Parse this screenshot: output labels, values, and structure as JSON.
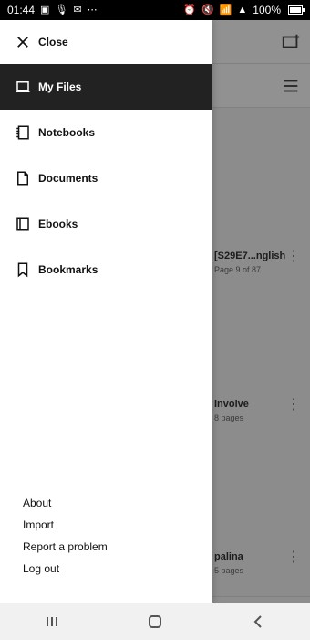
{
  "status_bar": {
    "time": "01:44",
    "left_icons": [
      "image-icon",
      "microphone-icon",
      "mail-icon",
      "more-icon"
    ],
    "right_icons": [
      "alarm-icon",
      "mute-icon",
      "wifi-icon",
      "signal-icon"
    ],
    "battery": "100%"
  },
  "drawer": {
    "close_label": "Close",
    "items": [
      {
        "label": "My Files",
        "icon": "laptop-icon",
        "active": true
      },
      {
        "label": "Notebooks",
        "icon": "notebook-icon",
        "active": false
      },
      {
        "label": "Documents",
        "icon": "document-icon",
        "active": false
      },
      {
        "label": "Ebooks",
        "icon": "book-icon",
        "active": false
      },
      {
        "label": "Bookmarks",
        "icon": "bookmark-icon",
        "active": false
      }
    ],
    "footer_links": [
      {
        "label": "About"
      },
      {
        "label": "Import"
      },
      {
        "label": "Report a problem"
      },
      {
        "label": "Log out"
      }
    ]
  },
  "background": {
    "files": [
      {
        "title": "[S29E7...nglish",
        "subtitle": "Page 9 of 87"
      },
      {
        "title": "Involve",
        "subtitle": "8 pages"
      },
      {
        "title": "palina",
        "subtitle": "5 pages"
      }
    ]
  },
  "colors": {
    "active_bg": "#222222",
    "drawer_bg": "#ffffff",
    "overlay": "rgba(0,0,0,0.42)"
  }
}
